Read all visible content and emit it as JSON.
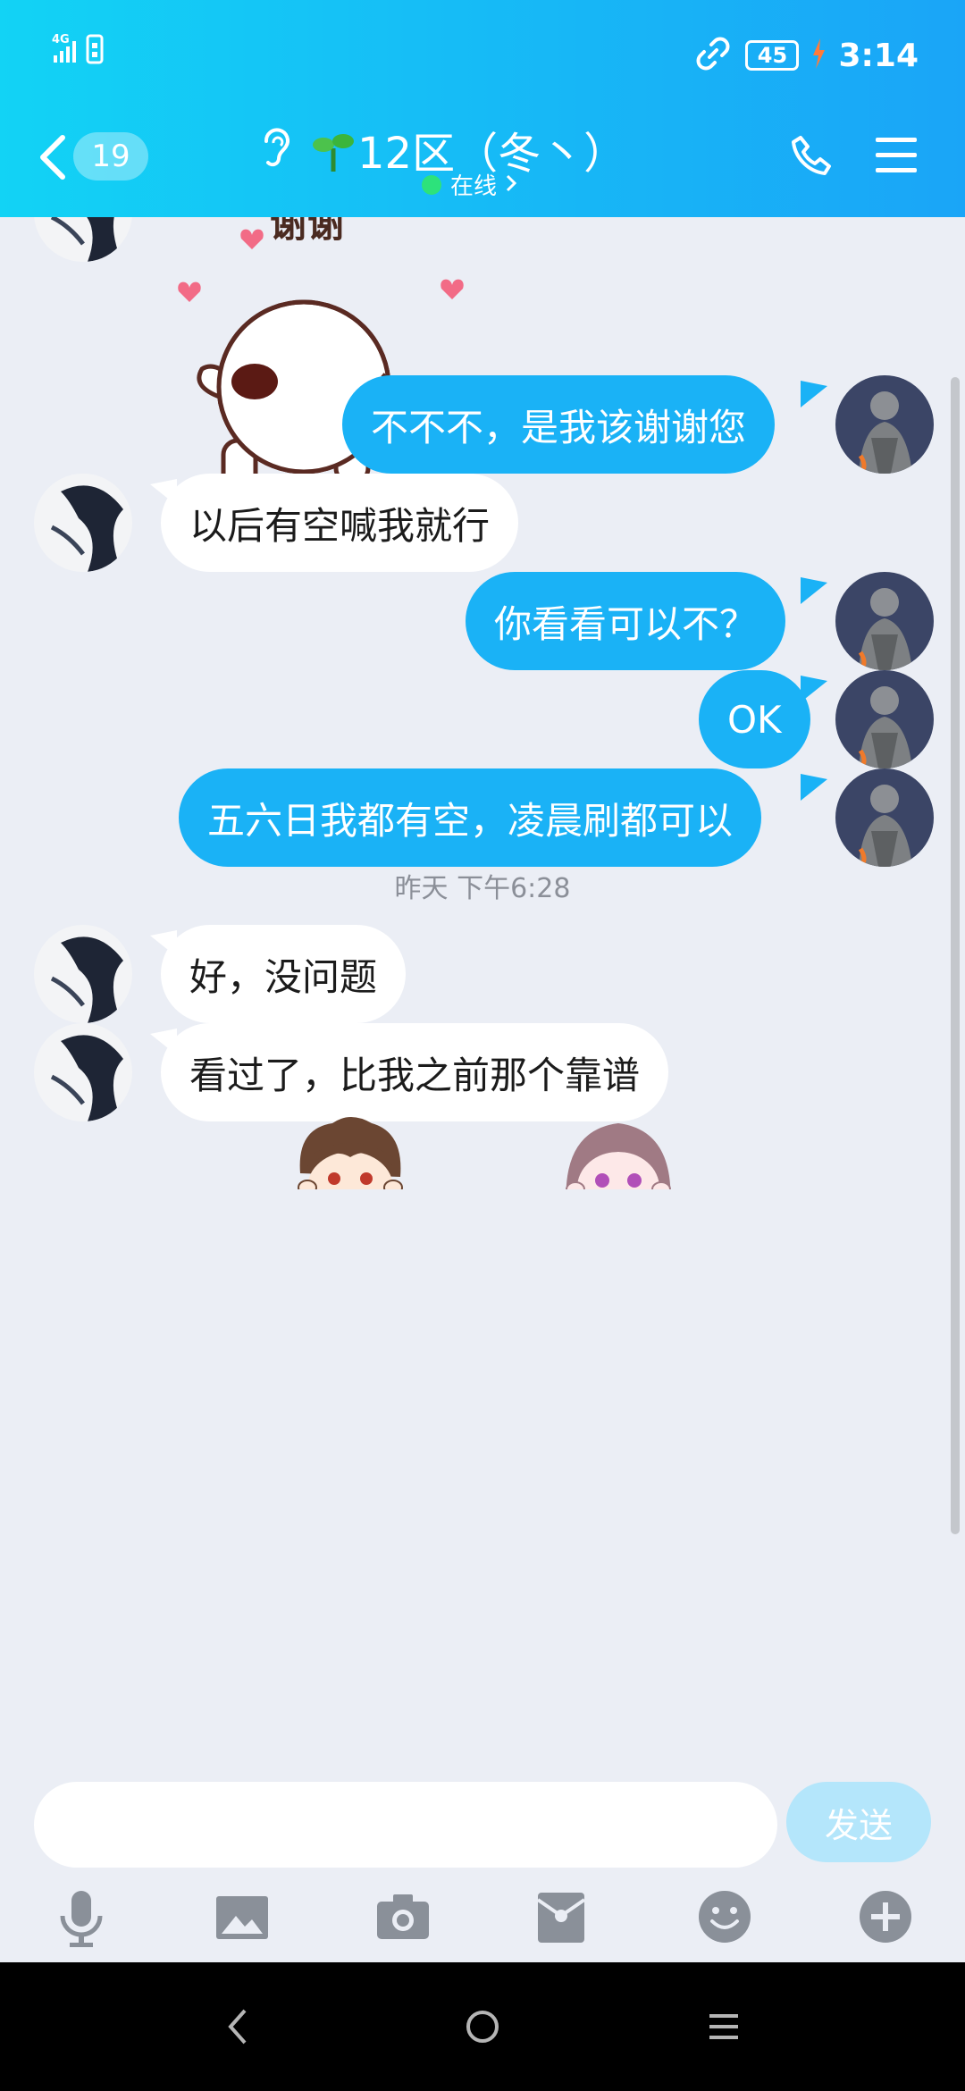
{
  "status_bar": {
    "network": "4G",
    "battery": "45",
    "time": "3:14"
  },
  "header": {
    "back_count": "19",
    "title": "12区（冬丶）",
    "status": "在线"
  },
  "messages": [
    {
      "side": "right",
      "text": "不不不，是我该谢谢您"
    },
    {
      "side": "left",
      "text": "以后有空喊我就行"
    },
    {
      "side": "right",
      "text": "你看看可以不？"
    },
    {
      "side": "right",
      "text": "OK"
    },
    {
      "side": "right",
      "text": "五六日我都有空，凌晨刷都可以"
    },
    {
      "side": "left",
      "text": "好，没问题"
    },
    {
      "side": "left",
      "text": "看过了，比我之前那个靠谱"
    }
  ],
  "sticker_text": "谢谢",
  "timestamp": "昨天 下午6:28",
  "input": {
    "placeholder": "",
    "send_label": "发送"
  },
  "toolbar_icons": [
    "microphone-icon",
    "image-icon",
    "camera-icon",
    "red-packet-icon",
    "emoji-icon",
    "plus-icon"
  ],
  "colors": {
    "accent": "#1ab2f6",
    "header_start": "#12d3f5",
    "header_end": "#1aa5f7",
    "chat_bg": "#ebeef5"
  }
}
